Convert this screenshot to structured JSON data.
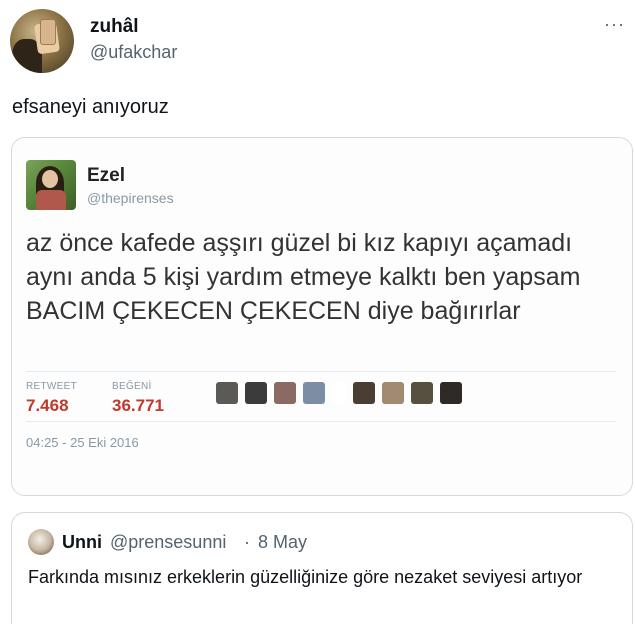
{
  "author": {
    "name": "zuhâl",
    "handle": "@ufakchar",
    "more_icon": "more-dots-icon"
  },
  "tweet": {
    "text": "efsaneyi anıyoruz"
  },
  "embedded_screenshot": {
    "name": "Ezel",
    "handle": "@thepirenses",
    "text": "az önce kafede aşşırı güzel bi kız kapıyı açamadı aynı anda 5 kişi yardım etmeye kalktı ben yapsam BACIM ÇEKECEN ÇEKECEN diye bağırırlar",
    "retweet_label": "RETWEET",
    "retweet_count": "7.468",
    "like_label": "BEĞENİ",
    "like_count": "36.771",
    "date": "04:25 - 25 Eki 2016",
    "stat_color": "#c0392b"
  },
  "quoted_tweet": {
    "name": "Unni",
    "handle": "@prensesunni",
    "separator": "·",
    "time": "8 May",
    "text": "Farkında mısınız erkeklerin güzelliğinize göre nezaket seviyesi artıyor"
  }
}
